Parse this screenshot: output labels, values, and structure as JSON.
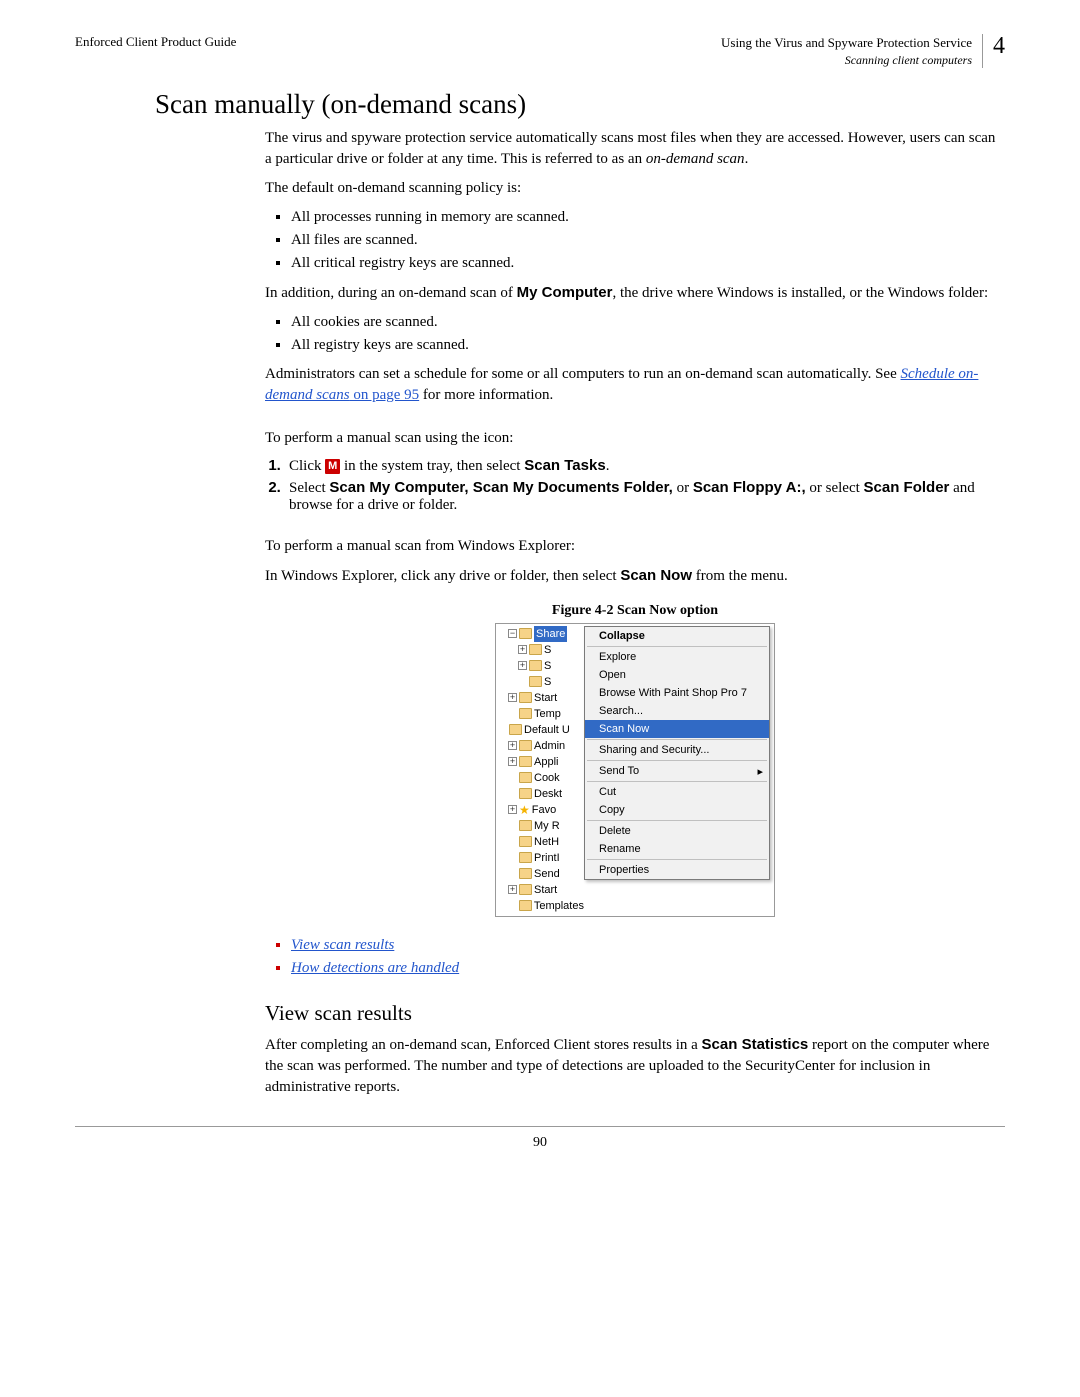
{
  "header": {
    "left": "Enforced Client Product Guide",
    "right_top": "Using the Virus and Spyware Protection Service",
    "right_sub": "Scanning client computers",
    "chapter": "4"
  },
  "h1": "Scan manually (on-demand scans)",
  "intro": {
    "p1a": "The virus and spyware protection service automatically scans most files when they are accessed. However, users can scan a particular drive or folder at any time. This is referred to as an ",
    "p1b": "on-demand scan",
    "p1c": ".",
    "p2": "The default on-demand scanning policy is:"
  },
  "policy_list": [
    "All processes running in memory are scanned.",
    "All files are scanned.",
    "All critical registry keys are scanned."
  ],
  "addition": {
    "pre": "In addition, during an on-demand scan of ",
    "bold": "My Computer",
    "post": ", the drive where Windows is installed, or the Windows folder:"
  },
  "addition_list": [
    "All cookies are scanned.",
    "All registry keys are scanned."
  ],
  "admin": {
    "pre": "Administrators can set a schedule for some or all computers to run an on-demand scan automatically. See ",
    "link_italic": "Schedule on-demand scans",
    "link_plain": " on page 95",
    "post": " for more information."
  },
  "icon_section": {
    "lead": "To perform a manual scan using the icon:",
    "step1_pre": "Click ",
    "step1_post": " in the system tray, then select ",
    "step1_bold": "Scan Tasks",
    "step1_end": ".",
    "step2_pre": "Select ",
    "step2_b1": "Scan My Computer, Scan My Documents Folder,",
    "step2_mid1": " or ",
    "step2_b2": "Scan Floppy A:,",
    "step2_mid2": " or select ",
    "step2_b3": "Scan Folder",
    "step2_end": " and browse for a drive or folder."
  },
  "explorer_section": {
    "lead": "To perform a manual scan from Windows Explorer:",
    "p_pre": "In Windows Explorer, click any drive or folder, then select ",
    "p_bold": "Scan Now",
    "p_post": " from the menu."
  },
  "figure_caption": "Figure 4-2  Scan Now option",
  "tree": [
    {
      "exp": "−",
      "lbl": "Share",
      "sel": true,
      "ind": 0
    },
    {
      "exp": "+",
      "lbl": "S",
      "ind": 1
    },
    {
      "exp": "+",
      "lbl": "S",
      "ind": 1
    },
    {
      "exp": " ",
      "lbl": "S",
      "ind": 1
    },
    {
      "exp": "+",
      "lbl": "Start",
      "ind": 0
    },
    {
      "exp": " ",
      "lbl": "Temp",
      "ind": 0
    },
    {
      "exp": " ",
      "lbl": "Default U",
      "ind": -1
    },
    {
      "exp": "+",
      "lbl": "Admin",
      "ind": 0
    },
    {
      "exp": "+",
      "lbl": "Appli",
      "ind": 0
    },
    {
      "exp": " ",
      "lbl": "Cook",
      "ind": 0
    },
    {
      "exp": " ",
      "lbl": "Deskt",
      "ind": 0
    },
    {
      "exp": "+",
      "lbl": "Favo",
      "ind": 0,
      "star": true
    },
    {
      "exp": " ",
      "lbl": "My R",
      "ind": 0
    },
    {
      "exp": " ",
      "lbl": "NetH",
      "ind": 0
    },
    {
      "exp": " ",
      "lbl": "PrintI",
      "ind": 0
    },
    {
      "exp": " ",
      "lbl": "Send",
      "ind": 0
    },
    {
      "exp": "+",
      "lbl": "Start",
      "ind": 0
    },
    {
      "exp": " ",
      "lbl": "Templates",
      "ind": 0
    }
  ],
  "ctx": [
    {
      "label": "Collapse",
      "bold": true
    },
    {
      "sep": true
    },
    {
      "label": "Explore"
    },
    {
      "label": "Open"
    },
    {
      "label": "Browse With Paint Shop Pro 7"
    },
    {
      "label": "Search..."
    },
    {
      "label": "Scan Now",
      "hl": true
    },
    {
      "sep": true
    },
    {
      "label": "Sharing and Security..."
    },
    {
      "sep": true
    },
    {
      "label": "Send To",
      "arrow": "▸"
    },
    {
      "sep": true
    },
    {
      "label": "Cut"
    },
    {
      "label": "Copy"
    },
    {
      "sep": true
    },
    {
      "label": "Delete"
    },
    {
      "label": "Rename"
    },
    {
      "sep": true
    },
    {
      "label": "Properties"
    }
  ],
  "links": [
    "View scan results",
    "How detections are handled"
  ],
  "h2": "View scan results",
  "results": {
    "pre": "After completing an on-demand scan, Enforced Client stores results in a ",
    "bold": "Scan Statistics",
    "post": " report on the computer where the scan was performed. The number and type of detections are uploaded to the SecurityCenter for inclusion in administrative reports."
  },
  "page_number": "90",
  "tray_glyph": "M"
}
